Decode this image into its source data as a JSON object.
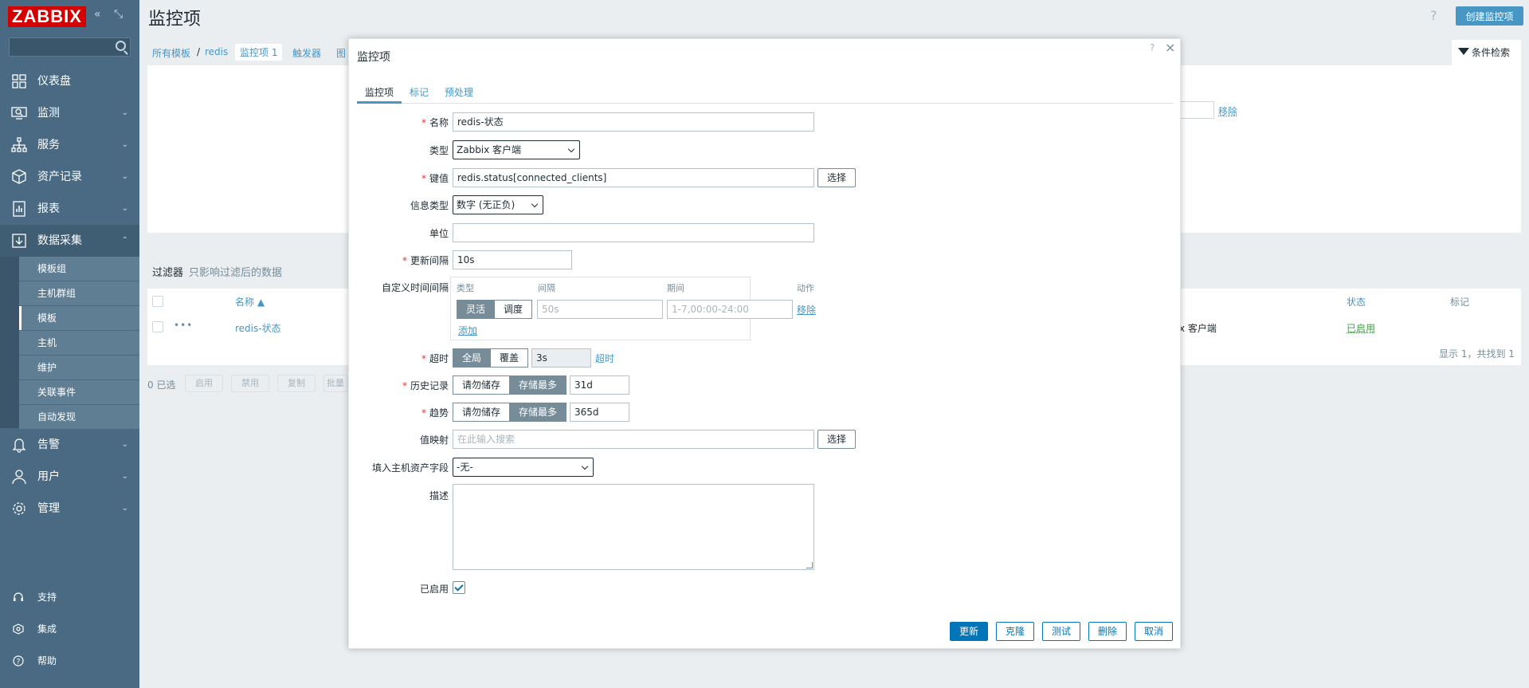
{
  "app": {
    "logo": "ZABBIX",
    "collapse_icon": "double-chevron-left-icon",
    "kiosk_icon": "fullscreen-icon"
  },
  "sidebar": {
    "search_placeholder": "",
    "items": [
      {
        "label": "仪表盘",
        "icon": "dashboard-icon"
      },
      {
        "label": "监测",
        "icon": "monitoring-icon"
      },
      {
        "label": "服务",
        "icon": "services-icon"
      },
      {
        "label": "资产记录",
        "icon": "inventory-icon"
      },
      {
        "label": "报表",
        "icon": "reports-icon"
      },
      {
        "label": "数据采集",
        "icon": "data-collection-icon"
      },
      {
        "label": "告警",
        "icon": "bell-icon"
      },
      {
        "label": "用户",
        "icon": "user-icon"
      },
      {
        "label": "管理",
        "icon": "gear-icon"
      }
    ],
    "submenu": [
      "模板组",
      "主机群组",
      "模板",
      "主机",
      "维护",
      "关联事件",
      "自动发现"
    ],
    "footer": [
      {
        "label": "支持",
        "icon": "headset-icon"
      },
      {
        "label": "集成",
        "icon": "integrations-icon"
      },
      {
        "label": "帮助",
        "icon": "help-icon"
      }
    ]
  },
  "header": {
    "title": "监控项",
    "help": "?",
    "create_button": "创建监控项"
  },
  "breadcrumb": {
    "all_templates": "所有模板",
    "sep": "/",
    "template": "redis",
    "items": "监控项",
    "items_count": "1",
    "triggers": "触发器",
    "graphs_partial": "图"
  },
  "filter": {
    "tab_label": "条件检索",
    "label": "过滤器",
    "note": "只影响过滤后的数据",
    "remove": "移除"
  },
  "list": {
    "col_name": "名称 ▲",
    "col_status": "状态",
    "col_tags": "标记",
    "row": {
      "dots": "•••",
      "name": "redis-状态",
      "type_partial": "x 客户端",
      "status": "已启用"
    },
    "footer": "显示 1，共找到 1",
    "selected": "0 已选",
    "mass_buttons": [
      "启用",
      "禁用",
      "复制",
      "批量"
    ]
  },
  "modal": {
    "title": "监控项",
    "help": "?",
    "close": "×",
    "tabs": [
      "监控项",
      "标记",
      "预处理"
    ],
    "fields": {
      "name": {
        "label": "名称",
        "value": "redis-状态"
      },
      "type": {
        "label": "类型",
        "value": "Zabbix 客户端"
      },
      "key": {
        "label": "键值",
        "value": "redis.status[connected_clients]",
        "button": "选择"
      },
      "info_type": {
        "label": "信息类型",
        "value": "数字 (无正负)"
      },
      "units": {
        "label": "单位",
        "value": ""
      },
      "interval": {
        "label": "更新间隔",
        "value": "10s"
      },
      "custom_intervals": {
        "label": "自定义时间间隔",
        "col_type": "类型",
        "col_interval": "间隔",
        "col_period": "期间",
        "col_action": "动作",
        "flexible": "灵活",
        "scheduling": "调度",
        "interval_placeholder": "50s",
        "period_placeholder": "1-7,00:00-24:00",
        "remove": "移除",
        "add": "添加"
      },
      "timeout": {
        "label": "超时",
        "global": "全局",
        "override": "覆盖",
        "value": "3s",
        "link": "超时"
      },
      "history": {
        "label": "历史记录",
        "no_store": "请勿储存",
        "store_up_to": "存储最多",
        "value": "31d"
      },
      "trends": {
        "label": "趋势",
        "no_store": "请勿储存",
        "store_up_to": "存储最多",
        "value": "365d"
      },
      "value_map": {
        "label": "值映射",
        "placeholder": "在此输入搜索",
        "button": "选择"
      },
      "inventory": {
        "label": "填入主机资产字段",
        "value": "-无-"
      },
      "description": {
        "label": "描述",
        "value": ""
      },
      "enabled": {
        "label": "已启用",
        "checked": true
      }
    },
    "buttons": {
      "update": "更新",
      "clone": "克隆",
      "test": "测试",
      "delete": "删除",
      "cancel": "取消"
    }
  },
  "colors": {
    "sidebar": "#496a82",
    "accent": "#0275b8",
    "logo": "#d40000",
    "enabled": "#429e47"
  }
}
